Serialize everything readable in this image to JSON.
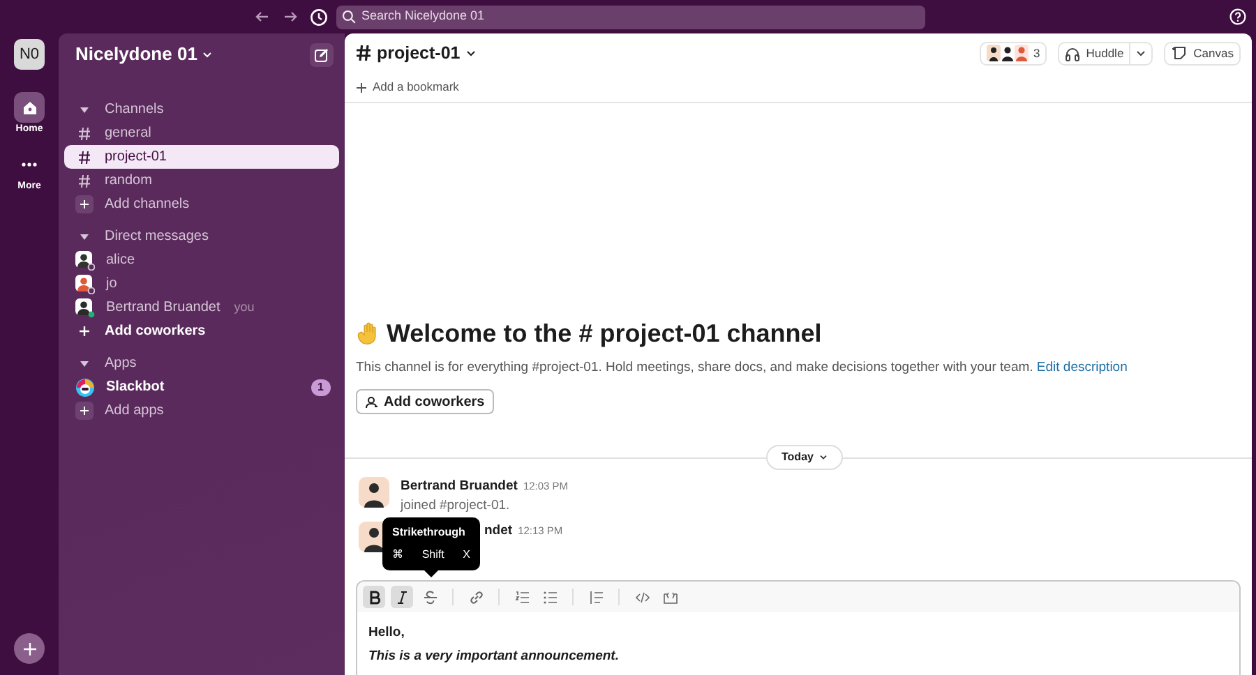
{
  "topbar": {
    "search_placeholder": "Search Nicelydone 01"
  },
  "workspace": {
    "initials": "N0",
    "name": "Nicelydone 01"
  },
  "rail": [
    {
      "label": "Home",
      "kind": "home",
      "selected": true
    },
    {
      "label": "More",
      "kind": "more",
      "selected": false
    }
  ],
  "sidebar": {
    "sections": [
      {
        "title": "Channels",
        "expanded": true,
        "items": [
          {
            "kind": "channel",
            "label": "general",
            "selected": false
          },
          {
            "kind": "channel",
            "label": "project-01",
            "selected": true
          },
          {
            "kind": "channel",
            "label": "random",
            "selected": false
          },
          {
            "kind": "add",
            "label": "Add channels"
          }
        ]
      },
      {
        "title": "Direct messages",
        "expanded": true,
        "items": [
          {
            "kind": "person",
            "label": "alice",
            "online": false,
            "color": "#333333"
          },
          {
            "kind": "person",
            "label": "jo",
            "online": false,
            "color": "#e05a3a"
          },
          {
            "kind": "person",
            "label": "Bertrand Bruandet",
            "suffix": "you",
            "online": true,
            "color": "#2b2b2b"
          },
          {
            "kind": "invite",
            "label": "Add coworkers"
          }
        ]
      },
      {
        "title": "Apps",
        "expanded": true,
        "items": [
          {
            "kind": "app",
            "label": "Slackbot",
            "unread": true,
            "badge": "1"
          },
          {
            "kind": "add",
            "label": "Add apps"
          }
        ]
      }
    ]
  },
  "channel": {
    "name": "project-01",
    "member_count": "3",
    "huddle": "Huddle",
    "canvas": "Canvas",
    "bookmark": "Add a bookmark"
  },
  "welcome": {
    "title": "Welcome to the # project-01 channel",
    "description": "This channel is for everything #project-01. Hold meetings, share docs, and make decisions together with your team.",
    "link": "Edit description",
    "button": "Add coworkers"
  },
  "divider": "Today",
  "messages": [
    {
      "name": "Bertrand Bruandet",
      "time": "12:03 PM",
      "text": "joined #project-01."
    },
    {
      "name": "ndet",
      "time": "12:13 PM"
    }
  ],
  "tooltip": {
    "title": "Strikethrough",
    "keys": [
      "⌘",
      "Shift",
      "X"
    ]
  },
  "composer": {
    "tools": [
      {
        "kind": "bold",
        "selected": true
      },
      {
        "kind": "italic",
        "selected": true
      },
      {
        "kind": "strike",
        "selected": false
      },
      {
        "kind": "sep"
      },
      {
        "kind": "link",
        "selected": false
      },
      {
        "kind": "sep"
      },
      {
        "kind": "olist",
        "selected": false
      },
      {
        "kind": "ulist",
        "selected": false
      },
      {
        "kind": "sep"
      },
      {
        "kind": "quote",
        "selected": false
      },
      {
        "kind": "sep"
      },
      {
        "kind": "code",
        "selected": false
      },
      {
        "kind": "codeblock",
        "selected": false
      }
    ],
    "lines": [
      {
        "text": "Hello,",
        "italic": false
      },
      {
        "text": "This is a very important announcement.",
        "italic": true
      }
    ]
  }
}
